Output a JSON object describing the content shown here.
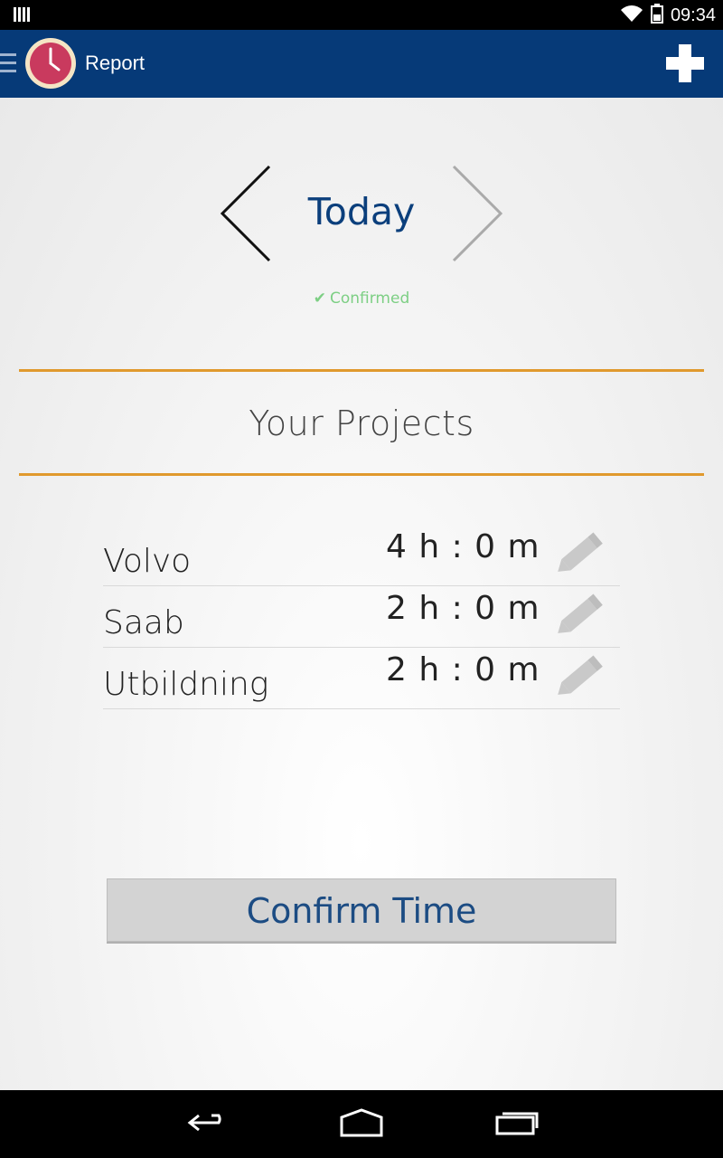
{
  "status_bar": {
    "time": "09:34"
  },
  "app_bar": {
    "title": "Report"
  },
  "date_nav": {
    "label": "Today",
    "status": "Confirmed"
  },
  "projects_section": {
    "title": "Your Projects",
    "items": [
      {
        "name": "Volvo",
        "time": "4 h : 0 m"
      },
      {
        "name": "Saab",
        "time": "2 h : 0 m"
      },
      {
        "name": "Utbildning",
        "time": "2 h : 0 m"
      }
    ]
  },
  "confirm_button": {
    "label": "Confirm Time"
  },
  "colors": {
    "app_bar": "#063a78",
    "accent_line": "#e0992d",
    "confirmed": "#7dcf84",
    "primary_text": "#0b3f7c"
  }
}
